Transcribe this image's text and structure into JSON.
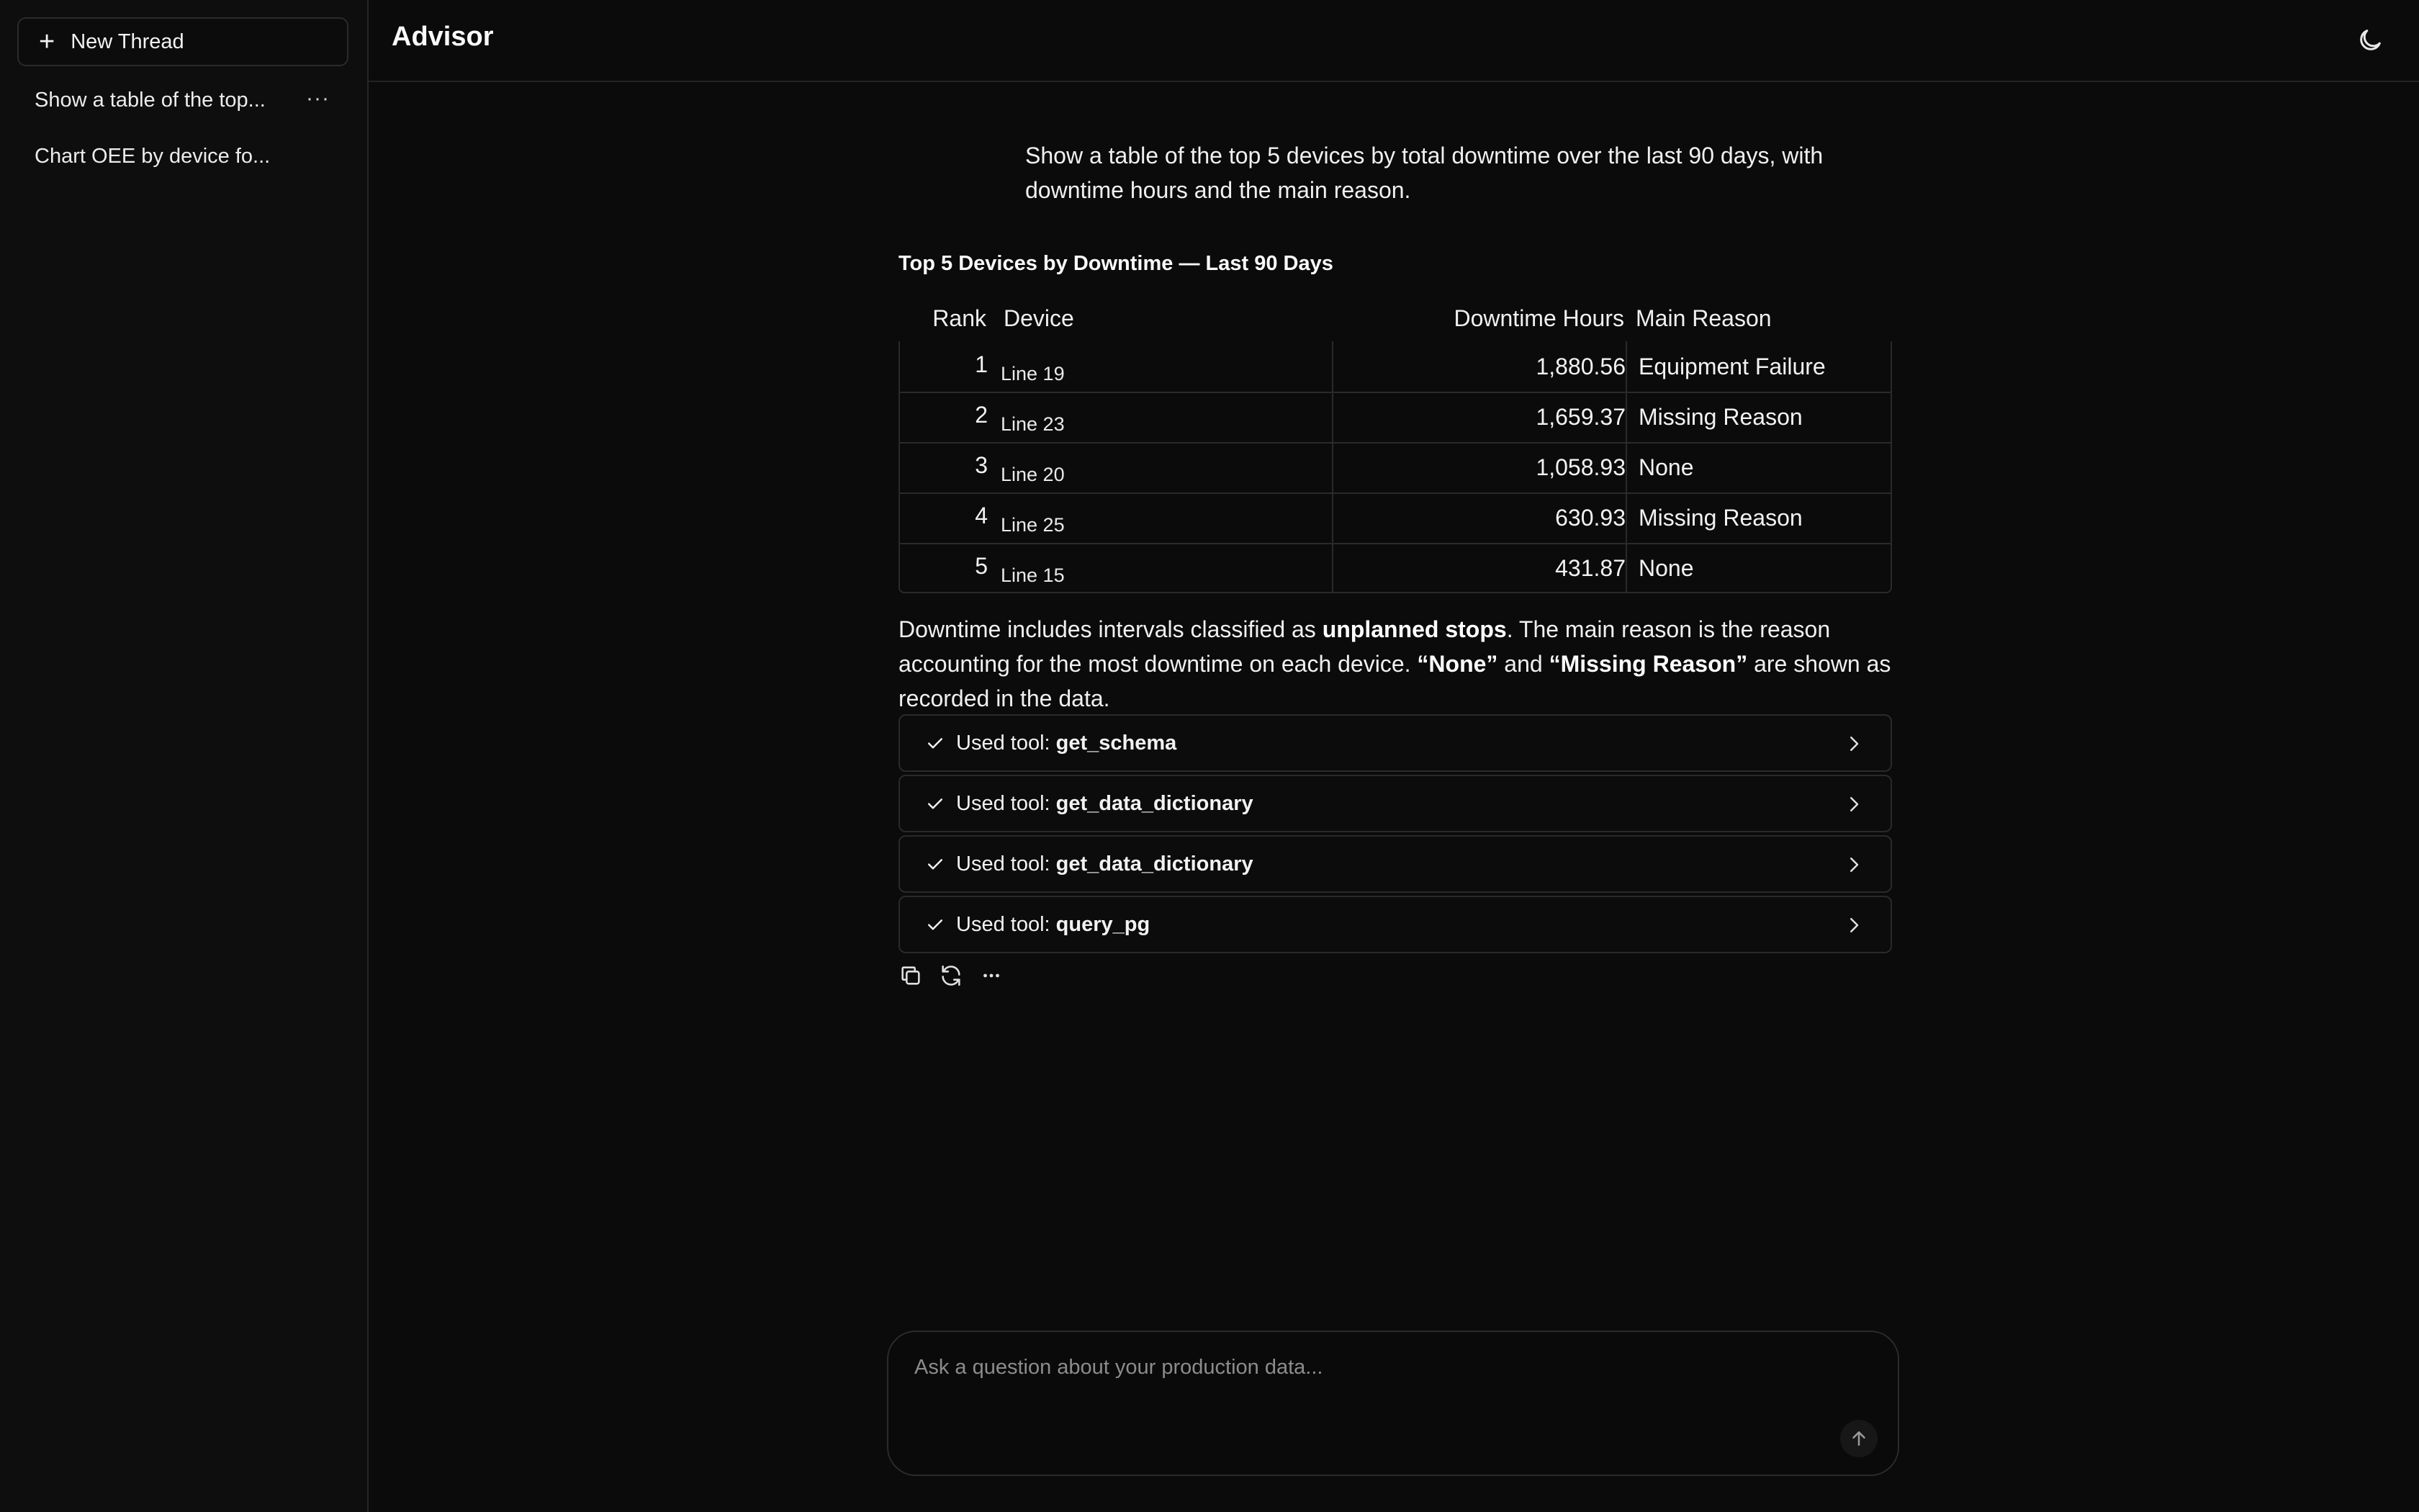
{
  "app": {
    "title": "Advisor"
  },
  "sidebar": {
    "new_thread_label": "New Thread",
    "threads": [
      {
        "label": "Show a table of the top...",
        "more": "···"
      },
      {
        "label": "Chart OEE by device fo..."
      }
    ]
  },
  "conversation": {
    "user_message": "Show a table of the top 5 devices by total downtime over the last 90 days, with downtime hours and the main reason.",
    "table": {
      "title": "Top 5 Devices by Downtime — Last 90 Days",
      "headers": [
        "Rank",
        "Device",
        "Downtime Hours",
        "Main Reason"
      ],
      "rows": [
        {
          "rank": "1",
          "device": "Line 19",
          "hours": "1,880.56",
          "reason": "Equipment Failure"
        },
        {
          "rank": "2",
          "device": "Line 23",
          "hours": "1,659.37",
          "reason": "Missing Reason"
        },
        {
          "rank": "3",
          "device": "Line 20",
          "hours": "1,058.93",
          "reason": "None"
        },
        {
          "rank": "4",
          "device": "Line 25",
          "hours": "630.93",
          "reason": "Missing Reason"
        },
        {
          "rank": "5",
          "device": "Line 15",
          "hours": "431.87",
          "reason": "None"
        }
      ]
    },
    "explanation": {
      "p1": "Downtime includes intervals classified as ",
      "b1": "unplanned stops",
      "p2": ". The main reason is the reason accounting for the most downtime on each device. ",
      "b2": "“None”",
      "p3": " and ",
      "b3": "“Missing Reason”",
      "p4": " are shown as recorded in the data."
    },
    "tools_prefix": "Used tool: ",
    "tools": [
      "get_schema",
      "get_data_dictionary",
      "get_data_dictionary",
      "query_pg"
    ]
  },
  "composer": {
    "placeholder": "Ask a question about your production data..."
  },
  "icons": {
    "plus": "plus-icon",
    "more": "more-horizontal-icon",
    "theme": "moon-icon",
    "check": "check-icon",
    "chevron": "chevron-right-icon",
    "copy": "copy-icon",
    "refresh": "refresh-icon",
    "send": "arrow-up-icon"
  }
}
